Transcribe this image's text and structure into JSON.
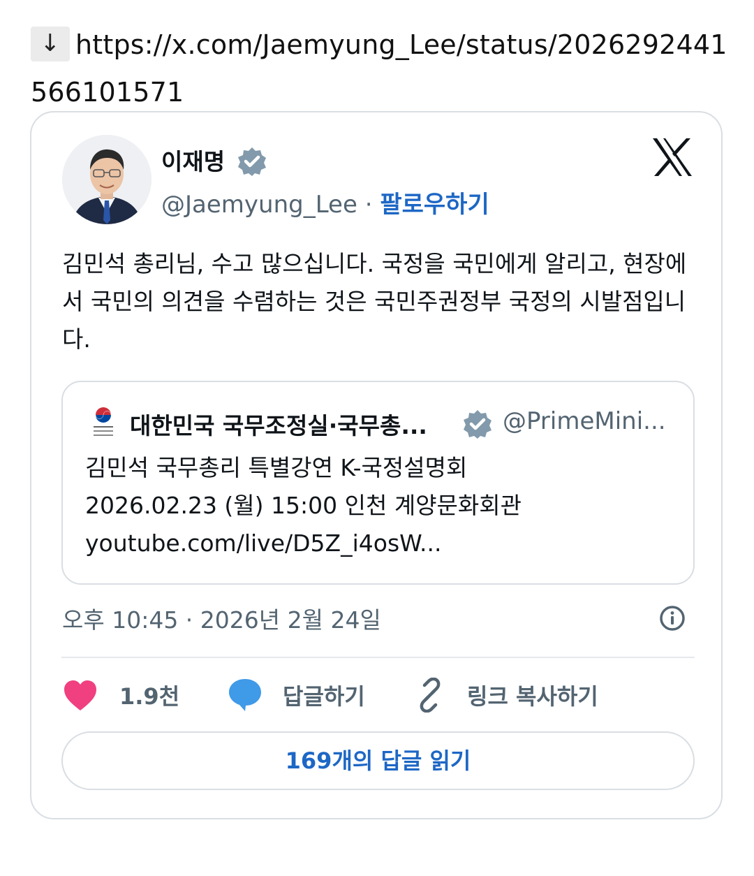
{
  "link": {
    "arrow": "↓",
    "url": "https://x.com/Jaemyung_Lee/status/2026292441566101571"
  },
  "tweet": {
    "author_name": "이재명",
    "handle": "@Jaemyung_Lee",
    "separator": "·",
    "follow_label": "팔로우하기",
    "body": "김민석 총리님, 수고 많으십니다. 국정을 국민에게 알리고, 현장에서 국민의 의견을 수렴하는 것은 국민주권정부 국정의 시발점입니다.",
    "timestamp": "오후 10:45 · 2026년 2월 24일",
    "likes_count": "1.9천",
    "reply_label": "답글하기",
    "copy_link_label": "링크 복사하기",
    "read_replies_label": "169개의 답글 읽기"
  },
  "quote": {
    "author_name": "대한민국 국무조정실·국무총...",
    "handle": "@PrimeMini...",
    "line1": "김민석 국무총리 특별강연 K-국정설명회",
    "line2": "2026.02.23 (월) 15:00 인천 계양문화회관",
    "line3": "youtube.com/live/D5Z_i4osW..."
  },
  "icons": {
    "download": "down-arrow-icon",
    "verified": "verified-badge-icon",
    "x_logo": "x-logo-icon",
    "info": "info-icon",
    "like": "heart-icon",
    "reply": "speech-bubble-icon",
    "copy": "link-icon"
  },
  "colors": {
    "accent_blue": "#1d67c5",
    "heart_pink": "#f0407f",
    "reply_blue": "#3f9ae8",
    "verified_gray": "#829aab",
    "secondary_text": "#536471",
    "border": "#d9dee3"
  }
}
